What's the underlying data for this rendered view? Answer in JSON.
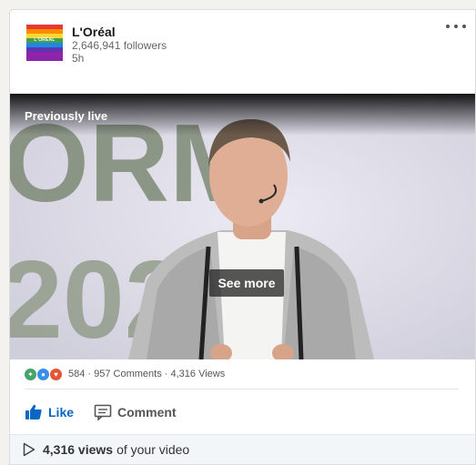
{
  "post": {
    "company": "L'Oréal",
    "followers": "2,646,941 followers",
    "time": "5h",
    "logo_text": "L'ORÉAL",
    "logo_stripes": [
      "#e53935",
      "#fb8c00",
      "#fdd835",
      "#43a047",
      "#1e88e5",
      "#8e24aa"
    ]
  },
  "video": {
    "badge": "Previously live",
    "see_more": "See more",
    "backdrop_text_top": "ORM",
    "backdrop_text_bottom": "202"
  },
  "social": {
    "reaction_icons": [
      "celebrate-icon",
      "like-icon",
      "love-icon"
    ],
    "counts_text": "584 · 957 Comments · 4,316 Views"
  },
  "actions": {
    "like_label": "Like",
    "comment_label": "Comment"
  },
  "footer": {
    "views_count": "4,316 views",
    "views_suffix": "of your video"
  },
  "colors": {
    "accent": "#0a66c2",
    "love": "#e55434",
    "celebrate": "#44a36a"
  }
}
